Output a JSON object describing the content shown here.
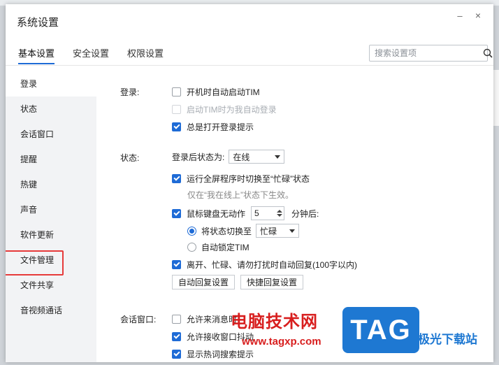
{
  "window": {
    "title": "系统设置",
    "minimize_glyph": "–",
    "close_glyph": "×"
  },
  "tabs": [
    {
      "label": "基本设置",
      "active": true
    },
    {
      "label": "安全设置",
      "active": false
    },
    {
      "label": "权限设置",
      "active": false
    }
  ],
  "search": {
    "placeholder": "搜索设置项",
    "value": ""
  },
  "sidebar": {
    "items": [
      {
        "label": "登录",
        "active": true
      },
      {
        "label": "状态"
      },
      {
        "label": "会话窗口"
      },
      {
        "label": "提醒"
      },
      {
        "label": "热键"
      },
      {
        "label": "声音"
      },
      {
        "label": "软件更新"
      },
      {
        "label": "文件管理",
        "highlighted": true
      },
      {
        "label": "文件共享"
      },
      {
        "label": "音视频通话"
      }
    ]
  },
  "login": {
    "label": "登录:",
    "auto_start": {
      "label": "开机时自动启动TIM",
      "checked": false
    },
    "auto_login": {
      "label": "启动TIM时为我自动登录",
      "checked": false,
      "disabled": true
    },
    "show_prompt": {
      "label": "总是打开登录提示",
      "checked": true
    }
  },
  "status": {
    "label": "状态:",
    "after_login_label": "登录后状态为:",
    "after_login_value": "在线",
    "fullscreen_busy": {
      "label": "运行全屏程序时切换至“忙碌”状态",
      "checked": true
    },
    "fullscreen_hint": "仅在“我在线上”状态下生效。",
    "idle": {
      "label": "鼠标键盘无动作",
      "checked": true,
      "minutes": "5",
      "suffix": "分钟后:"
    },
    "switch_status": {
      "label": "将状态切换至",
      "selected": true,
      "value": "忙碌"
    },
    "auto_lock": {
      "label": "自动锁定TIM",
      "selected": false
    },
    "auto_reply": {
      "label": "离开、忙碌、请勿打扰时自动回复(100字以内)",
      "checked": true
    },
    "buttons": {
      "auto_reply_settings": "自动回复设置",
      "quick_reply_settings": "快捷回复设置"
    }
  },
  "chat_window": {
    "label": "会话窗口:",
    "allow_popup": {
      "label": "允许来消息时",
      "checked": false
    },
    "allow_shake": {
      "label": "允许接收窗口抖动",
      "checked": true
    },
    "show_hot_search": {
      "label": "显示热词搜索提示",
      "checked": true
    }
  },
  "watermark": {
    "title": "电脑技术网",
    "url": "www.tagxp.com",
    "badge": "TAG",
    "site": "极光下载站"
  },
  "colors": {
    "accent": "#1e6bd6",
    "highlight_box": "#e63a3a",
    "sidebar_bg": "#f2f3f5",
    "watermark_red": "#d81e1e",
    "watermark_blue": "#1e78d2"
  }
}
